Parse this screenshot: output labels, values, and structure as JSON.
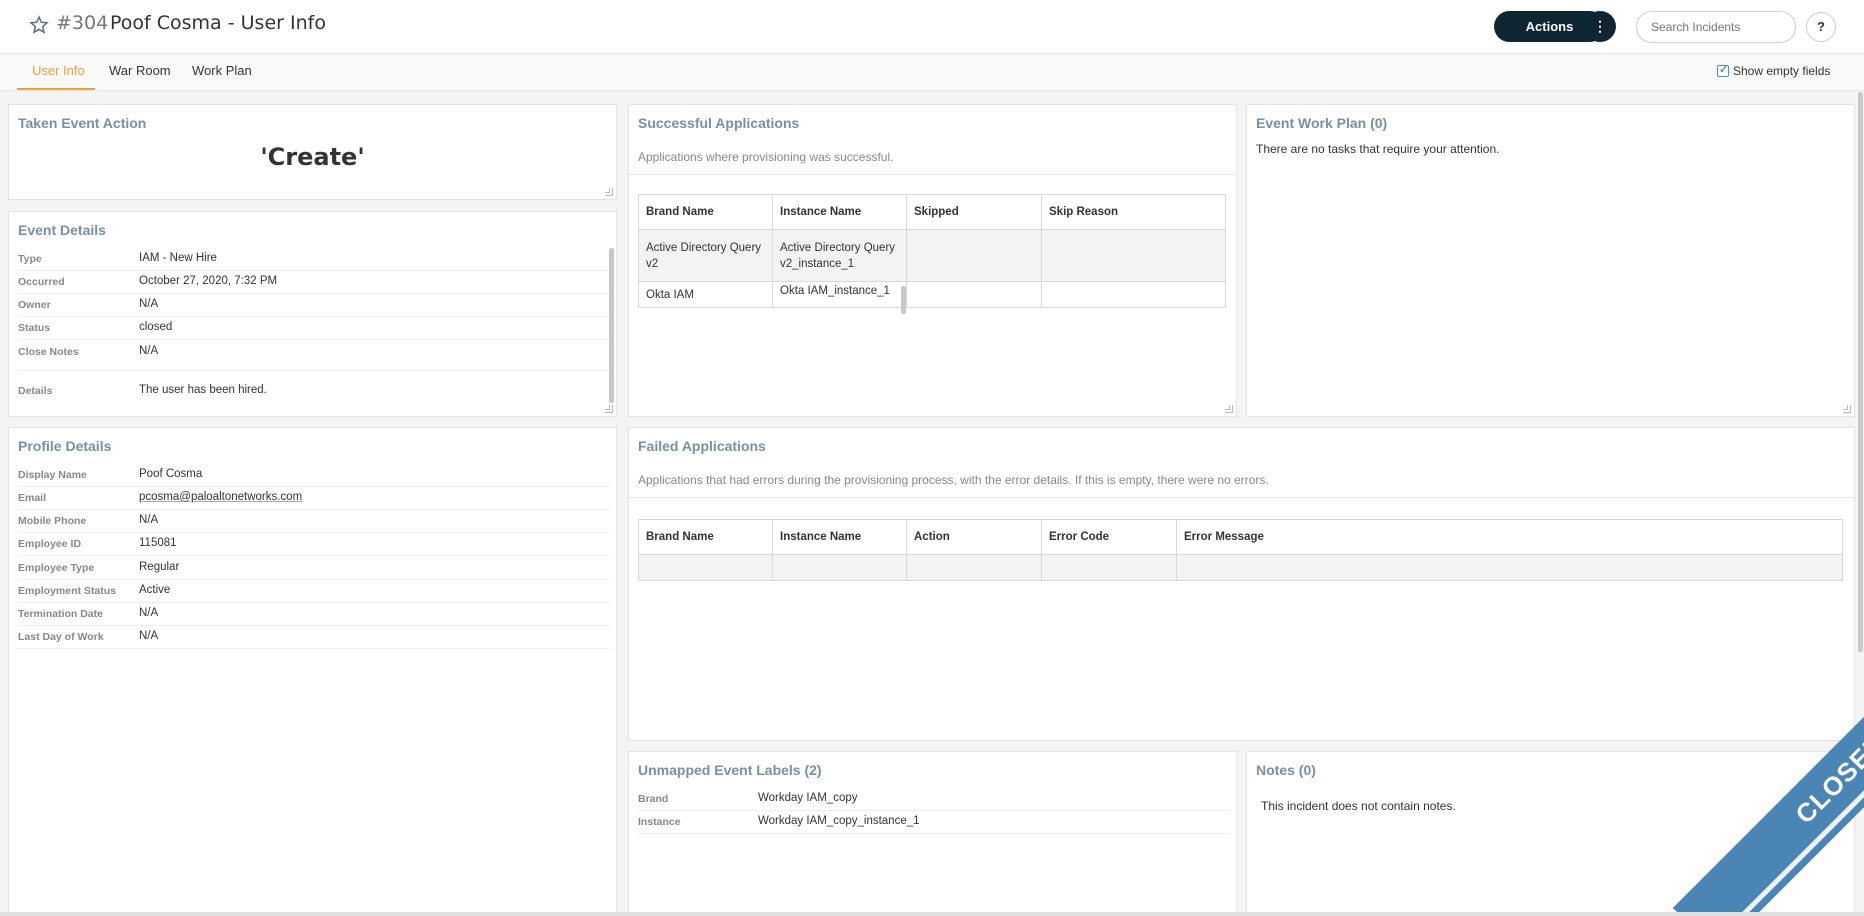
{
  "header": {
    "incident_number": "#304",
    "title": "Poof Cosma - User Info",
    "actions_label": "Actions",
    "more_label": "⋮",
    "search_placeholder": "Search Incidents",
    "help_label": "?"
  },
  "tabs": [
    {
      "label": "User Info",
      "active": true
    },
    {
      "label": "War Room",
      "active": false
    },
    {
      "label": "Work Plan",
      "active": false
    }
  ],
  "show_empty_fields": {
    "label": "Show empty fields",
    "checked": true
  },
  "taken_event_action": {
    "title": "Taken Event Action",
    "value": "'Create'"
  },
  "event_details": {
    "title": "Event Details",
    "rows": [
      {
        "key": "Type",
        "value": "IAM - New Hire"
      },
      {
        "key": "Occurred",
        "value": "October 27, 2020, 7:32 PM"
      },
      {
        "key": "Owner",
        "value": "N/A"
      },
      {
        "key": "Status",
        "value": "closed"
      },
      {
        "key": "Close Notes",
        "value": "N/A"
      },
      {
        "key": "Details",
        "value": "The user has been hired."
      }
    ]
  },
  "profile_details": {
    "title": "Profile Details",
    "rows": [
      {
        "key": "Display Name",
        "value": "Poof Cosma"
      },
      {
        "key": "Email",
        "value": "pcosma@paloaltonetworks.com"
      },
      {
        "key": "Mobile Phone",
        "value": "N/A"
      },
      {
        "key": "Employee ID",
        "value": "115081"
      },
      {
        "key": "Employee Type",
        "value": "Regular"
      },
      {
        "key": "Employment Status",
        "value": "Active"
      },
      {
        "key": "Termination Date",
        "value": "N/A"
      },
      {
        "key": "Last Day of Work",
        "value": "N/A"
      }
    ]
  },
  "successful_applications": {
    "title": "Successful Applications",
    "subtitle": "Applications where provisioning was successful.",
    "columns": [
      "Brand Name",
      "Instance Name",
      "Skipped",
      "Skip Reason"
    ],
    "rows": [
      [
        "Active Directory Query v2",
        "Active Directory Query v2_instance_1",
        "",
        ""
      ],
      [
        "Okta IAM",
        "Okta IAM_instance_1",
        "",
        ""
      ]
    ]
  },
  "event_work_plan": {
    "title": "Event Work Plan (0)",
    "message": "There are no tasks that require your attention."
  },
  "failed_applications": {
    "title": "Failed Applications",
    "subtitle": "Applications that had errors during the provisioning process, with the error details. If this is empty, there were no errors.",
    "columns": [
      "Brand Name",
      "Instance Name",
      "Action",
      "Error Code",
      "Error Message"
    ]
  },
  "unmapped_event_labels": {
    "title": "Unmapped Event Labels (2)",
    "rows": [
      {
        "key": "Brand",
        "value": "Workday IAM_copy"
      },
      {
        "key": "Instance",
        "value": "Workday IAM_copy_instance_1"
      }
    ]
  },
  "notes": {
    "title": "Notes (0)",
    "message": "This incident does not contain notes."
  },
  "status_ribbon": {
    "label": "CLOSED",
    "color": "#4a86b5"
  },
  "colors": {
    "accent": "#f0a033",
    "dark_button": "#0f2532",
    "card_title": "#7b8fa3"
  }
}
